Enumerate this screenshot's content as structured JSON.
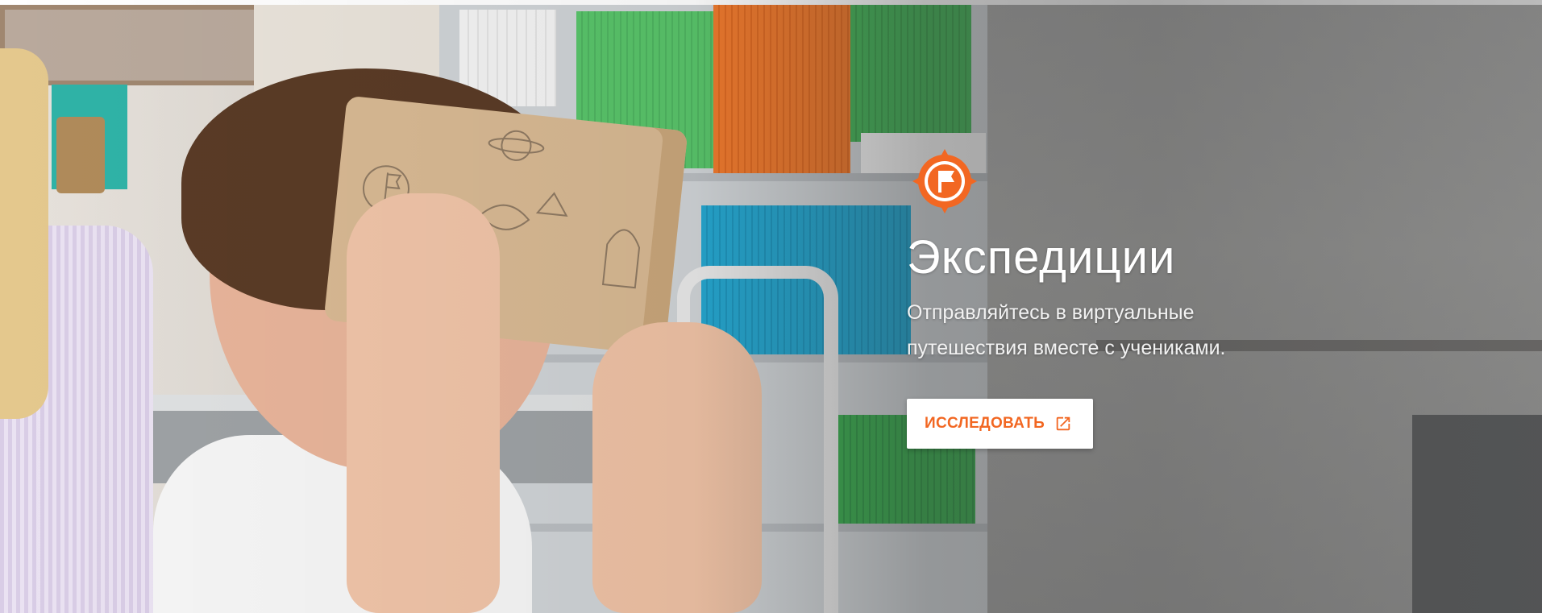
{
  "hero": {
    "title": "Экспедиции",
    "subtitle_line1": "Отправляйтесь в виртуальные",
    "subtitle_line2": "путешествия вместе с учениками.",
    "cta_label": "ИССЛЕДОВАТЬ",
    "cta_icon": "open-in-new-icon",
    "brand_icon": "expedition-flag-compass-icon",
    "colors": {
      "accent": "#F26722",
      "title_text": "#FFFFFF",
      "button_bg": "#FFFFFF"
    }
  }
}
